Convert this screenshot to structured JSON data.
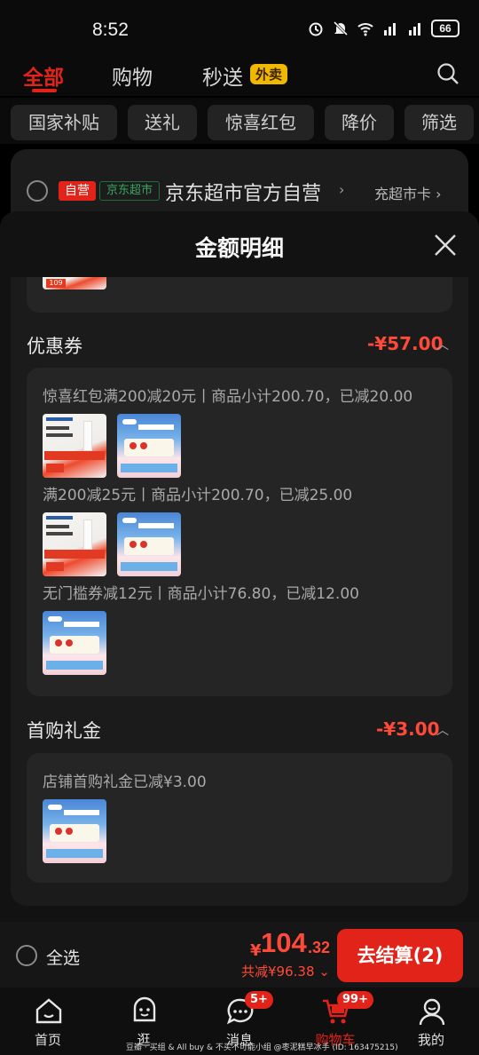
{
  "status_bar": {
    "time": "8:52",
    "battery": "66",
    "network1": "4G",
    "network2": "4G"
  },
  "top_tabs": {
    "all": "全部",
    "shopping": "购物",
    "express": "秒送",
    "takeout_badge": "外卖"
  },
  "chips": [
    "国家补贴",
    "送礼",
    "惊喜红包",
    "降价",
    "筛选"
  ],
  "store": {
    "self_badge": "自营",
    "mart_badge": "京东超市",
    "name": "京东超市官方自营",
    "card_link": "充超市卡"
  },
  "sheet": {
    "title": "金额明细",
    "partial_price": "109",
    "coupons": {
      "title": "优惠券",
      "amount": "-¥57.00",
      "lines": [
        "惊喜红包满200减20元丨商品小计200.70，已减20.00",
        "满200减25元丨商品小计200.70，已减25.00",
        "无门槛券减12元丨商品小计76.80，已减12.00"
      ]
    },
    "first_gift": {
      "title": "首购礼金",
      "amount": "-¥3.00",
      "line": "店铺首购礼金已减¥3.00"
    }
  },
  "checkout": {
    "select_all": "全选",
    "currency": "¥",
    "price_int": "104",
    "price_dec": ".32",
    "saved": "共减¥96.38",
    "button": "去结算(2)"
  },
  "nav": [
    {
      "label": "首页",
      "icon": "home-icon"
    },
    {
      "label": "逛",
      "icon": "browse-face-icon"
    },
    {
      "label": "消息",
      "icon": "message-icon",
      "badge": "5+"
    },
    {
      "label": "购物车",
      "icon": "cart-icon",
      "badge": "99+"
    },
    {
      "label": "我的",
      "icon": "profile-icon"
    }
  ],
  "watermark": "豆瓣 · 买组 & All buy & 不买不可能小组 @枣泥糕早冰手 (ID: 163475215)",
  "colors": {
    "accent": "#e2231a",
    "price": "#ff4a3a",
    "takeout": "#f1b800"
  }
}
